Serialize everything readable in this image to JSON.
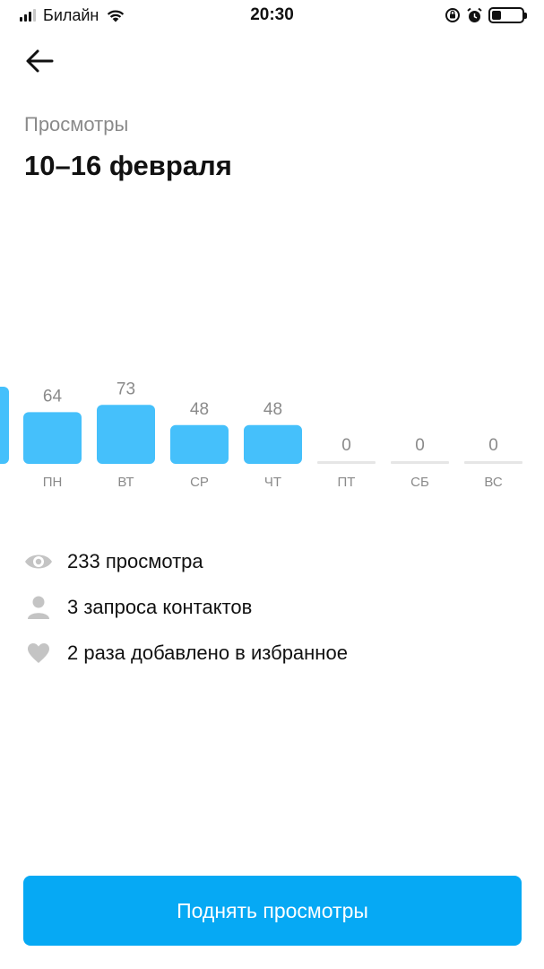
{
  "status_bar": {
    "carrier": "Билайн",
    "time": "20:30",
    "battery_level": 0.3,
    "icons": [
      "signal-icon",
      "wifi-icon",
      "orientation-lock-icon",
      "alarm-icon",
      "battery-icon"
    ]
  },
  "header": {
    "back_icon": "arrow-left-icon",
    "subtitle": "Просмотры",
    "title": "10–16 февраля"
  },
  "chart_data": {
    "type": "bar",
    "categories": [
      "ПН",
      "ВТ",
      "СР",
      "ЧТ",
      "ПТ",
      "СБ",
      "ВС"
    ],
    "values": [
      64,
      73,
      48,
      48,
      0,
      0,
      0
    ],
    "value_labels": [
      "64",
      "73",
      "48",
      "48",
      "0",
      "0",
      "0"
    ],
    "partial_previous_bar_visible": true,
    "bar_color": "#45c0fb",
    "zero_bar_color": "#e6e6e6",
    "label_color": "#8a8a8a"
  },
  "stats": [
    {
      "icon": "eye-icon",
      "text": "233 просмотра"
    },
    {
      "icon": "person-icon",
      "text": "3 запроса контактов"
    },
    {
      "icon": "heart-icon",
      "text": "2 раза добавлено в избранное"
    }
  ],
  "cta": {
    "label": "Поднять просмотры",
    "color": "#06a9f4"
  }
}
